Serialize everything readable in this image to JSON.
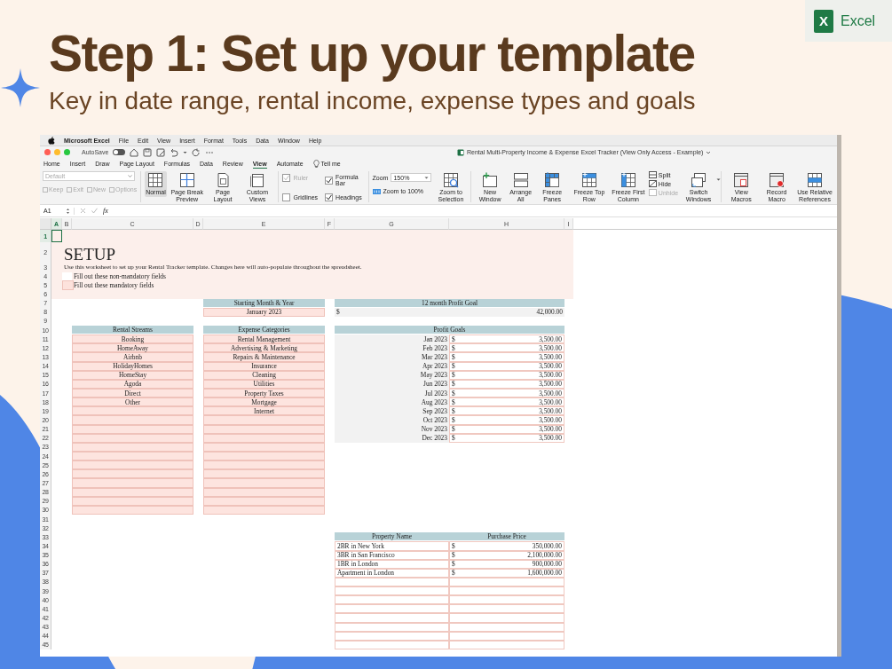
{
  "hero": {
    "title": "Step 1: Set up your template",
    "subtitle": "Key in date range, rental income, expense types and goals",
    "badge_letter": "X",
    "badge_label": "Excel"
  },
  "menu_bar": {
    "app": "Microsoft Excel",
    "items": [
      "File",
      "Edit",
      "View",
      "Insert",
      "Format",
      "Tools",
      "Data",
      "Window",
      "Help"
    ]
  },
  "title_bar": {
    "autosave": {
      "label": "AutoSave",
      "on": false
    },
    "document": "Rental Multi-Property Income & Expense Excel Tracker (View Only Access - Example)"
  },
  "tabs": [
    {
      "label": "Home",
      "selected": false
    },
    {
      "label": "Insert",
      "selected": false
    },
    {
      "label": "Draw",
      "selected": false
    },
    {
      "label": "Page Layout",
      "selected": false
    },
    {
      "label": "Formulas",
      "selected": false
    },
    {
      "label": "Data",
      "selected": false
    },
    {
      "label": "Review",
      "selected": false
    },
    {
      "label": "View",
      "selected": true
    },
    {
      "label": "Automate",
      "selected": false
    }
  ],
  "tell_me": "Tell me",
  "ribbon": {
    "style_box": {
      "value": "Default",
      "disabled": true
    },
    "style_actions": [
      {
        "label": "Keep",
        "disabled": true
      },
      {
        "label": "Exit",
        "disabled": true
      },
      {
        "label": "New",
        "disabled": true
      },
      {
        "label": "Options",
        "disabled": true
      }
    ],
    "views": [
      {
        "label": "Normal",
        "kind": "normal",
        "selected": true
      },
      {
        "label": "Page Break Preview",
        "kind": "page-break",
        "selected": false
      },
      {
        "label": "Page Layout",
        "kind": "page-layout",
        "selected": false
      },
      {
        "label": "Custom Views",
        "kind": "custom-views",
        "selected": false
      }
    ],
    "show": [
      {
        "label": "Ruler",
        "checked": true,
        "disabled": true
      },
      {
        "label": "Formula Bar",
        "checked": true,
        "disabled": false
      },
      {
        "label": "Gridlines",
        "checked": false,
        "disabled": false
      },
      {
        "label": "Headings",
        "checked": true,
        "disabled": false
      }
    ],
    "zoom": {
      "label": "Zoom",
      "value": "150%",
      "reset": "Zoom to 100%",
      "selection": "Zoom to Selection"
    },
    "window_buttons": [
      {
        "label": "New Window",
        "kind": "new-window"
      },
      {
        "label": "Arrange All",
        "kind": "arrange"
      },
      {
        "label": "Freeze Panes",
        "kind": "freeze"
      },
      {
        "label": "Freeze Top Row",
        "kind": "freeze-row"
      },
      {
        "label": "Freeze First Column",
        "kind": "freeze-col"
      }
    ],
    "window_small": [
      {
        "label": "Split",
        "kind": "split",
        "disabled": false
      },
      {
        "label": "Hide",
        "kind": "hide",
        "disabled": false
      },
      {
        "label": "Unhide",
        "kind": "unhide",
        "disabled": true
      }
    ],
    "switch": {
      "label": "Switch Windows",
      "kind": "switch"
    },
    "macros": [
      {
        "label": "View Macros",
        "kind": "view-macros"
      },
      {
        "label": "Record Macro",
        "kind": "record-macro"
      },
      {
        "label": "Use Relative References",
        "kind": "relative"
      }
    ]
  },
  "formula_bar": {
    "name_box": "A1",
    "fx": "fx"
  },
  "grid": {
    "columns": [
      {
        "label": "A",
        "selected": true
      },
      {
        "label": "B",
        "selected": false
      },
      {
        "label": "C",
        "selected": false
      },
      {
        "label": "D",
        "selected": false
      },
      {
        "label": "E",
        "selected": false
      },
      {
        "label": "F",
        "selected": false
      },
      {
        "label": "G",
        "selected": false
      },
      {
        "label": "H",
        "selected": false
      },
      {
        "label": "I",
        "selected": false
      }
    ],
    "rows": [
      {
        "label": "1",
        "selected": true
      },
      {
        "label": "2",
        "selected": false
      },
      {
        "label": "3",
        "selected": false
      },
      {
        "label": "4",
        "selected": false
      },
      {
        "label": "5",
        "selected": false
      },
      {
        "label": "6",
        "selected": false
      },
      {
        "label": "7",
        "selected": false
      },
      {
        "label": "8",
        "selected": false
      },
      {
        "label": "9",
        "selected": false
      },
      {
        "label": "10",
        "selected": false
      },
      {
        "label": "11",
        "selected": false
      },
      {
        "label": "12",
        "selected": false
      },
      {
        "label": "13",
        "selected": false
      },
      {
        "label": "14",
        "selected": false
      },
      {
        "label": "15",
        "selected": false
      },
      {
        "label": "16",
        "selected": false
      },
      {
        "label": "17",
        "selected": false
      },
      {
        "label": "18",
        "selected": false
      },
      {
        "label": "19",
        "selected": false
      },
      {
        "label": "20",
        "selected": false
      },
      {
        "label": "21",
        "selected": false
      },
      {
        "label": "22",
        "selected": false
      },
      {
        "label": "23",
        "selected": false
      },
      {
        "label": "24",
        "selected": false
      },
      {
        "label": "25",
        "selected": false
      },
      {
        "label": "26",
        "selected": false
      },
      {
        "label": "27",
        "selected": false
      },
      {
        "label": "28",
        "selected": false
      },
      {
        "label": "29",
        "selected": false
      },
      {
        "label": "30",
        "selected": false
      },
      {
        "label": "31",
        "selected": false
      },
      {
        "label": "32",
        "selected": false
      },
      {
        "label": "33",
        "selected": false
      },
      {
        "label": "34",
        "selected": false
      },
      {
        "label": "35",
        "selected": false
      },
      {
        "label": "36",
        "selected": false
      },
      {
        "label": "37",
        "selected": false
      },
      {
        "label": "38",
        "selected": false
      },
      {
        "label": "39",
        "selected": false
      },
      {
        "label": "40",
        "selected": false
      },
      {
        "label": "41",
        "selected": false
      },
      {
        "label": "42",
        "selected": false
      },
      {
        "label": "43",
        "selected": false
      },
      {
        "label": "44",
        "selected": false
      },
      {
        "label": "45",
        "selected": false
      }
    ]
  },
  "sheet": {
    "title": "SETUP",
    "description": "Use this worksheet to set up your Rental Tracker template. Changes here will auto-populate throughout the spreadsheet.",
    "legend": [
      {
        "kind": "optional",
        "label": "Fill out these non-mandatory fields"
      },
      {
        "kind": "mandatory",
        "label": "Fill out these mandatory fields"
      }
    ],
    "start_month": {
      "header": "Starting Month & Year",
      "value": "January 2023"
    },
    "profit_goal": {
      "header": "12 month Profit Goal",
      "currency": "$",
      "value": "42,000.00"
    },
    "rental_streams": {
      "header": "Rental Streams",
      "items": [
        "Booking",
        "HomeAway",
        "Airbnb",
        "HolidayHomes",
        "HomeStay",
        "Agoda",
        "Direct",
        "Other"
      ]
    },
    "expense_categories": {
      "header": "Expense Categories",
      "items": [
        "Rental Management",
        "Advertising & Marketing",
        "Repairs & Maintenance",
        "Insurance",
        "Cleaning",
        "Utilities",
        "Property Taxes",
        "Mortgage",
        "Internet"
      ]
    },
    "profit_goals": {
      "header": "Profit Goals",
      "rows": [
        {
          "month": "Jan 2023",
          "currency": "$",
          "amount": "3,500.00"
        },
        {
          "month": "Feb 2023",
          "currency": "$",
          "amount": "3,500.00"
        },
        {
          "month": "Mar 2023",
          "currency": "$",
          "amount": "3,500.00"
        },
        {
          "month": "Apr 2023",
          "currency": "$",
          "amount": "3,500.00"
        },
        {
          "month": "May 2023",
          "currency": "$",
          "amount": "3,500.00"
        },
        {
          "month": "Jun 2023",
          "currency": "$",
          "amount": "3,500.00"
        },
        {
          "month": "Jul 2023",
          "currency": "$",
          "amount": "3,500.00"
        },
        {
          "month": "Aug 2023",
          "currency": "$",
          "amount": "3,500.00"
        },
        {
          "month": "Sep 2023",
          "currency": "$",
          "amount": "3,500.00"
        },
        {
          "month": "Oct 2023",
          "currency": "$",
          "amount": "3,500.00"
        },
        {
          "month": "Nov 2023",
          "currency": "$",
          "amount": "3,500.00"
        },
        {
          "month": "Dec 2023",
          "currency": "$",
          "amount": "3,500.00"
        }
      ]
    },
    "properties": {
      "columns": [
        "Property Name",
        "Purchase Price"
      ],
      "rows": [
        {
          "name": "2BR in New York",
          "currency": "$",
          "price": "350,000.00"
        },
        {
          "name": "3BR in San Francisco",
          "currency": "$",
          "price": "2,100,000.00"
        },
        {
          "name": "1BR in London",
          "currency": "$",
          "price": "900,000.00"
        },
        {
          "name": "Apartment in London",
          "currency": "$",
          "price": "1,600,000.00"
        }
      ]
    }
  }
}
